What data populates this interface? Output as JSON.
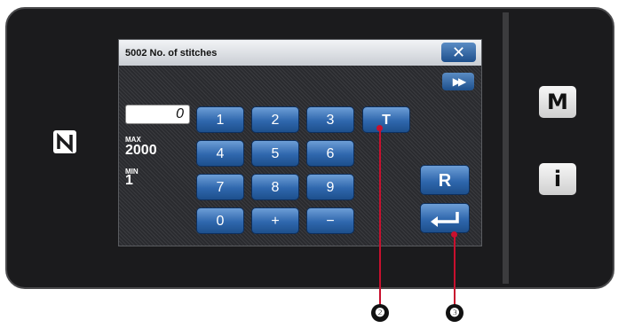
{
  "window": {
    "title": "5002 No. of stitches",
    "close_label": "✕",
    "next_label": "▶▶"
  },
  "input": {
    "value": "0"
  },
  "limits": {
    "max_label": "MAX",
    "max_value": "2000",
    "min_label": "MIN",
    "min_value": "1"
  },
  "keypad": {
    "row1": [
      "1",
      "2",
      "3",
      "T"
    ],
    "row2": [
      "4",
      "5",
      "6"
    ],
    "row3": [
      "7",
      "8",
      "9"
    ],
    "row4": [
      "0",
      "+",
      "−"
    ]
  },
  "side_keys": {
    "reset_label": "R",
    "enter_label": "⏎"
  },
  "device": {
    "menu_label": "M",
    "info_label": "i"
  },
  "callouts": [
    "❷",
    "❸"
  ],
  "colors": {
    "accent": "#c8102e",
    "key_blue": "#2f67ad",
    "bezel": "#1b1b1d"
  }
}
